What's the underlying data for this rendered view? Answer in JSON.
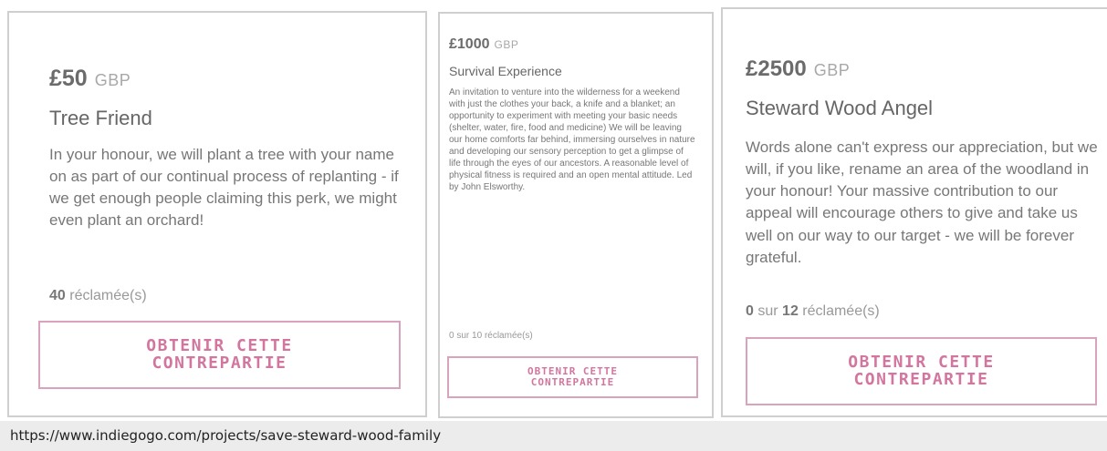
{
  "perks": [
    {
      "amount": "£50",
      "currency": "GBP",
      "title": "Tree Friend",
      "description": "In your honour, we will plant a tree with your name on as part of our continual process of replanting - if we get enough people claiming this perk, we might even plant an orchard!",
      "claimed_count": "40",
      "claimed_label": "réclamée(s)",
      "cta_line1": "OBTENIR CETTE",
      "cta_line2": "CONTREPARTIE"
    },
    {
      "amount": "£1000",
      "currency": "GBP",
      "title": "Survival Experience",
      "description": "An invitation to venture into the wilderness for a weekend with just the clothes your back, a knife and a blanket; an opportunity to experiment with meeting your basic needs (shelter, water, fire, food and medicine) We will be leaving our home comforts far behind, immersing ourselves in nature and developing our sensory perception to get a glimpse of life through the eyes of our ancestors. A reasonable level of physical fitness is required and an open mental attitude. Led by John Elsworthy.",
      "claimed_count": "0",
      "claimed_sep": "sur",
      "claimed_total": "10",
      "claimed_label": "réclamée(s)",
      "cta_line1": "OBTENIR CETTE",
      "cta_line2": "CONTREPARTIE"
    },
    {
      "amount": "£2500",
      "currency": "GBP",
      "title": "Steward Wood Angel",
      "description": "Words alone can't express our appreciation, but we will, if you like, rename an area of the woodland in your honour! Your massive contribution to our appeal will encourage others to give and take us well on our way to our target - we will be forever grateful.",
      "claimed_count": "0",
      "claimed_sep": "sur",
      "claimed_total": "12",
      "claimed_label": "réclamée(s)",
      "cta_line1": "OBTENIR CETTE",
      "cta_line2": "CONTREPARTIE"
    }
  ],
  "source_url": "https://www.indiegogo.com/projects/save-steward-wood-family",
  "colors": {
    "accent": "#d3769f",
    "accent_border": "#d9a3bd",
    "card_border": "#cfcfcf",
    "url_bar": "#ececec"
  }
}
